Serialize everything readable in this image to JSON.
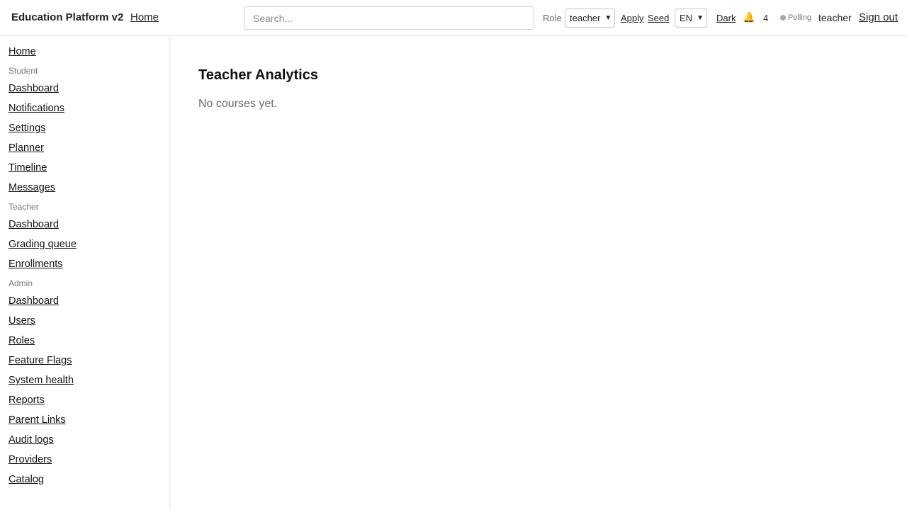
{
  "header": {
    "brand": "Education Platform v2",
    "separator": "·",
    "home_link": "Home",
    "search_placeholder": "Search...",
    "role_label": "Role",
    "role_value": "teacher",
    "apply_label": "Apply",
    "seed_label": "Seed",
    "lang_value": "EN",
    "theme_label": "Dark",
    "bell_icon": "🔔",
    "notification_count": "4",
    "status_label": "Polling",
    "username": "teacher",
    "signout_label": "Sign out"
  },
  "sidebar": {
    "home": "Home",
    "student_section": "Student",
    "student_items": [
      "Dashboard",
      "Notifications",
      "Settings",
      "Planner",
      "Timeline",
      "Messages"
    ],
    "teacher_section": "Teacher",
    "teacher_items": [
      "Dashboard",
      "Grading queue",
      "Enrollments"
    ],
    "admin_section": "Admin",
    "admin_items": [
      "Dashboard",
      "Users",
      "Roles",
      "Feature Flags",
      "System health",
      "Reports",
      "Parent Links",
      "Audit logs",
      "Providers",
      "Catalog"
    ]
  },
  "main": {
    "title": "Teacher Analytics",
    "empty_message": "No courses yet."
  },
  "colors": {
    "status_dot": "#a8a8a8",
    "bell": "#f0b429",
    "muted_text": "#6b6b6b"
  }
}
